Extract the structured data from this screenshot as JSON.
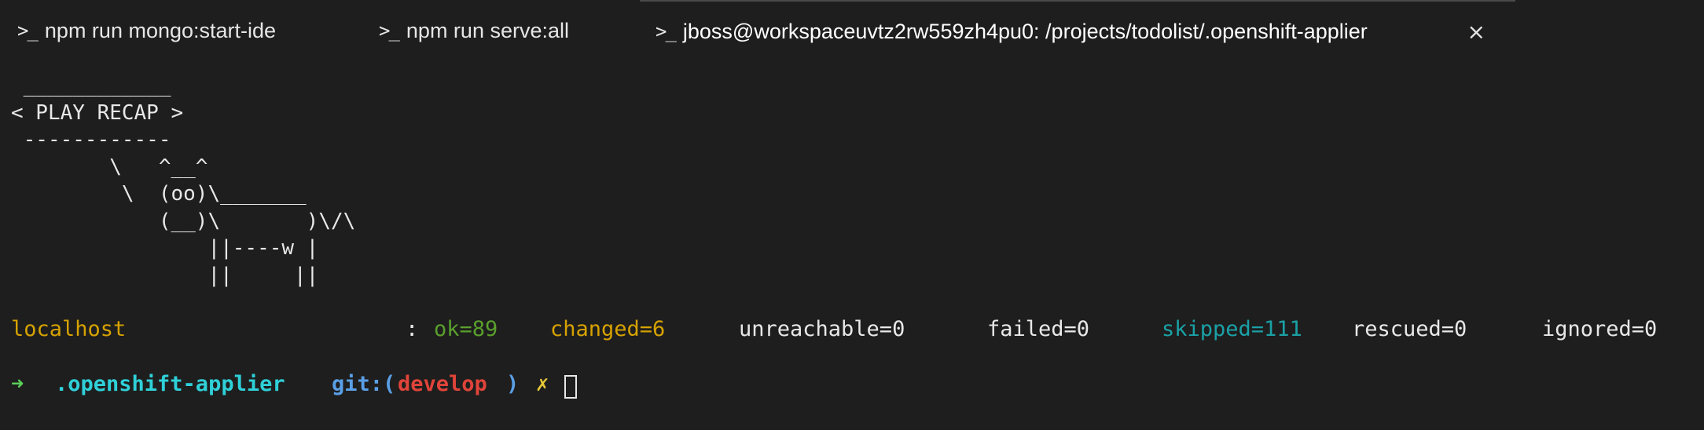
{
  "tabs": [
    {
      "icon": "terminal-prompt-icon",
      "label": "npm run mongo:start-ide"
    },
    {
      "icon": "terminal-prompt-icon",
      "label": "npm run serve:all"
    },
    {
      "icon": "terminal-prompt-icon",
      "label": "jboss@workspaceuvtz2rw559zh4pu0: /projects/todolist/.openshift-applier",
      "active": true,
      "close_glyph": "×"
    }
  ],
  "prompt_glyph": ">_",
  "terminal": {
    "art": " ____________\n< PLAY RECAP >\n ------------\n        \\   ^__^\n         \\  (oo)\\_______\n            (__)\\       )\\/\\\n                ||----w |\n                ||     ||",
    "recap": {
      "host": "localhost",
      "colon": ":",
      "ok": "ok=89",
      "changed": "changed=6",
      "unreachable": "unreachable=0",
      "failed": "failed=0",
      "skipped": "skipped=111",
      "rescued": "rescued=0",
      "ignored": "ignored=0"
    },
    "prompt": {
      "arrow": "➜",
      "directory": ".openshift-applier",
      "git_prefix": "git:(",
      "branch": "develop",
      "git_suffix": ")",
      "dirty_marker": "✗"
    }
  },
  "colors": {
    "background": "#1e1e1e",
    "host": "#d6a200",
    "ok": "#5aa02c",
    "changed": "#d6a200",
    "skipped": "#1aa1a6",
    "prompt_arrow": "#5ad05a",
    "prompt_dir": "#2fd0d8",
    "git_label": "#5a9fe6",
    "branch": "#e0443a",
    "dirty": "#e8c93a"
  }
}
